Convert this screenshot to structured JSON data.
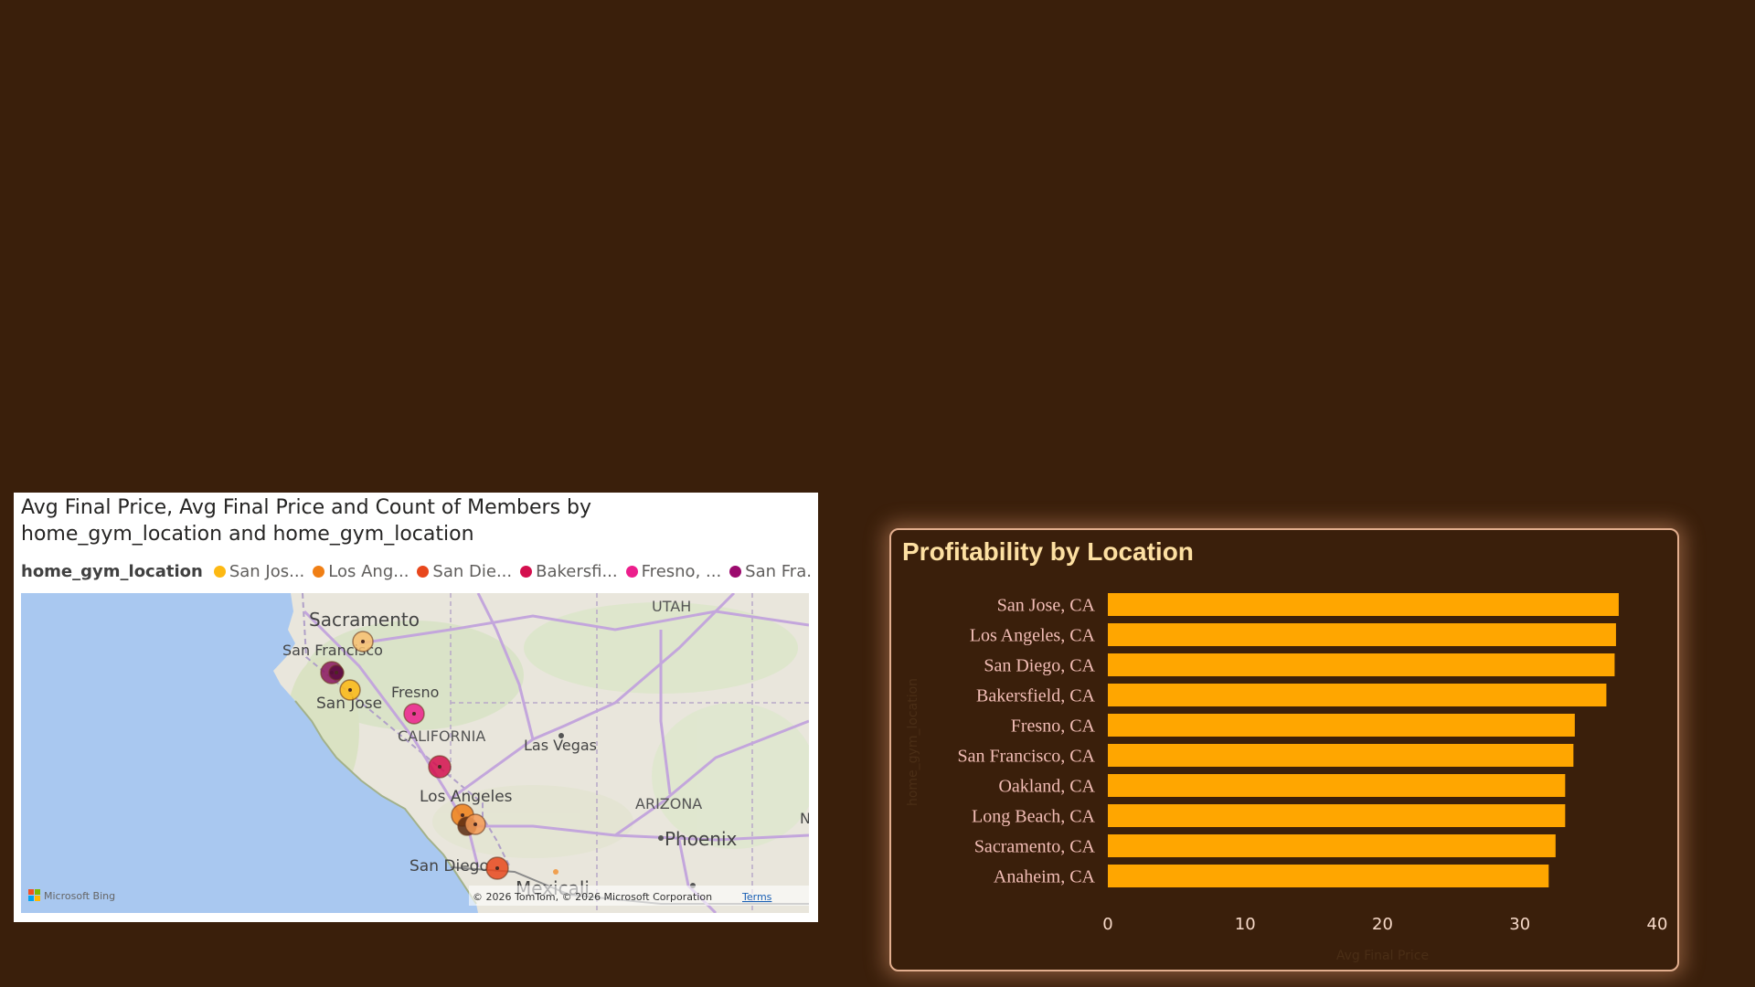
{
  "map_visual": {
    "title_line1": "Avg Final Price, Avg Final Price and Count of Members by",
    "title_line2": "home_gym_location and home_gym_location",
    "legend_title": "home_gym_location",
    "legend_items": [
      {
        "label": "San Jos...",
        "color": "#fdb913"
      },
      {
        "label": "Los Ang...",
        "color": "#f07f15"
      },
      {
        "label": "San Die...",
        "color": "#e8471c"
      },
      {
        "label": "Bakersfi...",
        "color": "#d40f4e"
      },
      {
        "label": "Fresno, ...",
        "color": "#ec1e8c"
      },
      {
        "label": "San Fra...",
        "color": "#9c0a6e"
      }
    ],
    "map_labels": {
      "sacramento": "Sacramento",
      "san_francisco": "San Francisco",
      "san_jose": "San Jose",
      "fresno": "Fresno",
      "california": "CALIFORNIA",
      "las_vegas": "Las Vegas",
      "utah": "UTAH",
      "arizona": "ARIZONA",
      "phoenix": "Phoenix",
      "los_angeles": "Los Angeles",
      "san_diego": "San Diego",
      "mexicali": "Mexicali",
      "edge_n": "N"
    },
    "attribution": "© 2026 TomTom, © 2026 Microsoft Corporation",
    "terms_label": "Terms",
    "bing_label": "Microsoft Bing",
    "bubbles": [
      {
        "name": "Sacramento",
        "color": "#f8c070"
      },
      {
        "name": "San Francisco",
        "color": "#8a1560"
      },
      {
        "name": "Oakland",
        "color": "#5a0a40"
      },
      {
        "name": "San Jose",
        "color": "#fdb913"
      },
      {
        "name": "Fresno",
        "color": "#ec1e8c"
      },
      {
        "name": "Bakersfield",
        "color": "#d40f4e"
      },
      {
        "name": "Los Angeles",
        "color": "#f07f15"
      },
      {
        "name": "Long Beach",
        "color": "#5a2a10"
      },
      {
        "name": "Anaheim",
        "color": "#f59a55"
      },
      {
        "name": "San Diego",
        "color": "#e8471c"
      }
    ]
  },
  "chart_data": {
    "type": "bar",
    "orientation": "horizontal",
    "title": "Profitability by Location",
    "categories": [
      "San Jose, CA",
      "Los Angeles, CA",
      "San Diego, CA",
      "Bakersfield, CA",
      "Fresno, CA",
      "San Francisco, CA",
      "Oakland, CA",
      "Long Beach, CA",
      "Sacramento, CA",
      "Anaheim, CA"
    ],
    "values": [
      37.2,
      37.0,
      36.9,
      36.3,
      34.0,
      33.9,
      33.3,
      33.3,
      32.6,
      32.1
    ],
    "x_ticks": [
      "0",
      "10",
      "20",
      "30",
      "40"
    ],
    "xlim": [
      0,
      40
    ],
    "xlabel": "Avg Final Price",
    "ylabel": "home_gym_location",
    "bar_color": "#ffa600",
    "label_color": "#f2bdb6",
    "title_color": "#fde0a2",
    "grid": false
  }
}
